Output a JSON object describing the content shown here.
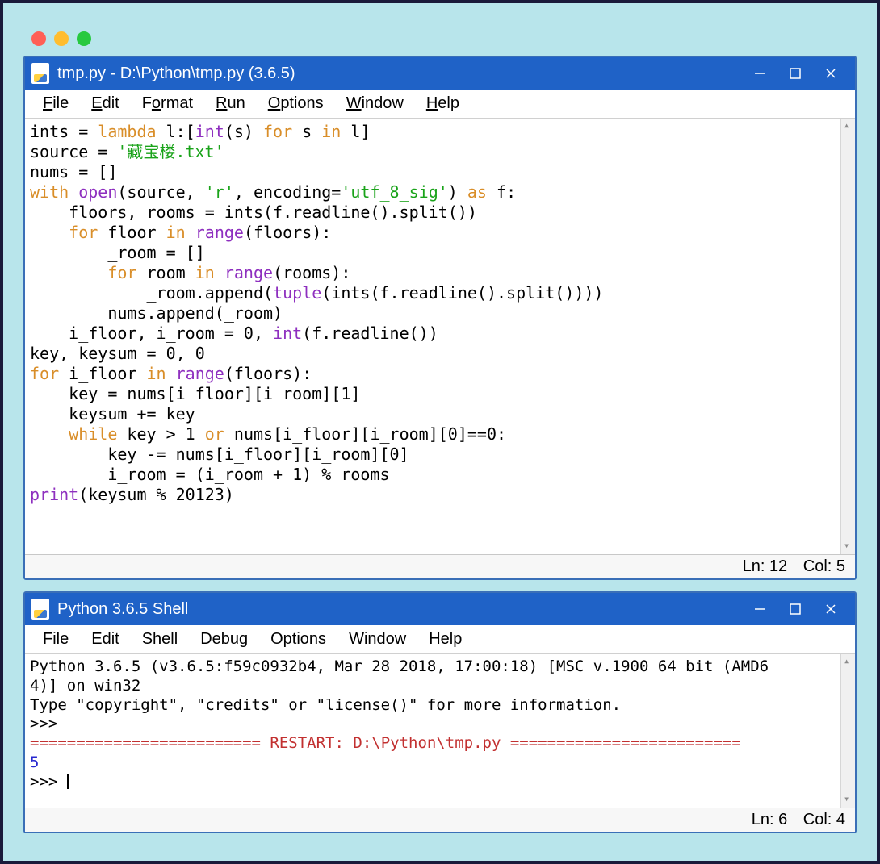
{
  "editor": {
    "title": "tmp.py - D:\\Python\\tmp.py (3.6.5)",
    "menus": [
      "File",
      "Edit",
      "Format",
      "Run",
      "Options",
      "Window",
      "Help"
    ],
    "status": {
      "ln": "Ln: 12",
      "col": "Col: 5"
    },
    "code": {
      "l1": {
        "a": "ints = ",
        "b": "lambda",
        "c": " l:[",
        "d": "int",
        "e": "(s) ",
        "f": "for",
        "g": " s ",
        "h": "in",
        "i": " l]"
      },
      "l2": {
        "a": "source = ",
        "b": "'藏宝楼.txt'"
      },
      "l3": "nums = []",
      "l4": {
        "a": "with",
        "b": " ",
        "c": "open",
        "d": "(source, ",
        "e": "'r'",
        "f": ", encoding=",
        "g": "'utf_8_sig'",
        "h": ") ",
        "i": "as",
        "j": " f:"
      },
      "l5": "    floors, rooms = ints(f.readline().split())",
      "l6": {
        "a": "    ",
        "b": "for",
        "c": " floor ",
        "d": "in",
        "e": " ",
        "f": "range",
        "g": "(floors):"
      },
      "l7": "        _room = []",
      "l8": {
        "a": "        ",
        "b": "for",
        "c": " room ",
        "d": "in",
        "e": " ",
        "f": "range",
        "g": "(rooms):"
      },
      "l9": {
        "a": "            _room.append(",
        "b": "tuple",
        "c": "(ints(f.readline().split())))"
      },
      "l10": "        nums.append(_room)",
      "l11": {
        "a": "    i_floor, i_room = 0, ",
        "b": "int",
        "c": "(f.readline())"
      },
      "l12": "key, keysum = 0, 0",
      "l13": {
        "a": "for",
        "b": " i_floor ",
        "c": "in",
        "d": " ",
        "e": "range",
        "f": "(floors):"
      },
      "l14": "    key = nums[i_floor][i_room][1]",
      "l15": "    keysum += key",
      "l16": {
        "a": "    ",
        "b": "while",
        "c": " key > 1 ",
        "d": "or",
        "e": " nums[i_floor][i_room][0]==0:"
      },
      "l17": "        key -= nums[i_floor][i_room][0]",
      "l18": "        i_room = (i_room + 1) % rooms",
      "l19": {
        "a": "print",
        "b": "(keysum % 20123)"
      }
    }
  },
  "shell": {
    "title": "Python 3.6.5 Shell",
    "menus": [
      "File",
      "Edit",
      "Shell",
      "Debug",
      "Options",
      "Window",
      "Help"
    ],
    "status": {
      "ln": "Ln: 6",
      "col": "Col: 4"
    },
    "out": {
      "l1": "Python 3.6.5 (v3.6.5:f59c0932b4, Mar 28 2018, 17:00:18) [MSC v.1900 64 bit (AMD6",
      "l2": "4)] on win32",
      "l3": "Type \"copyright\", \"credits\" or \"license()\" for more information.",
      "l4": ">>> ",
      "l5a": "=========================",
      "l5b": " RESTART: D:\\Python\\tmp.py ",
      "l5c": "=========================",
      "l6": "5",
      "l7": ">>> "
    }
  }
}
